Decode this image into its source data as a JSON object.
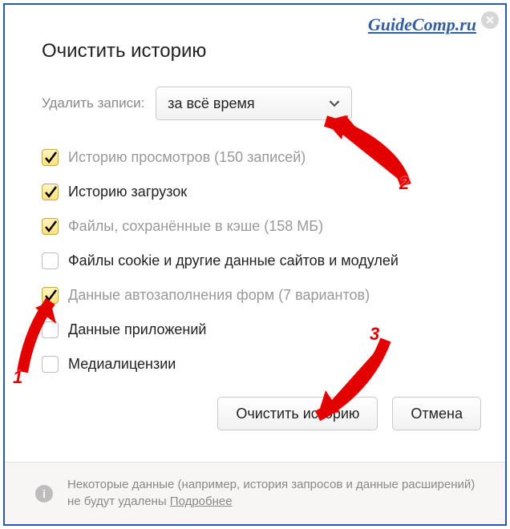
{
  "watermark": "GuideComp.ru",
  "title": "Очистить историю",
  "select": {
    "label": "Удалить записи:",
    "value": "за всё время"
  },
  "options": [
    {
      "checked": true,
      "label": "Историю просмотров",
      "suffix": " (150 записей)",
      "dim": true
    },
    {
      "checked": true,
      "label": "Историю загрузок",
      "suffix": "",
      "dim": false
    },
    {
      "checked": true,
      "label": "Файлы, сохранённые в кэше",
      "suffix": " (158 МБ)",
      "dim": true
    },
    {
      "checked": false,
      "label": "Файлы cookie и другие данные сайтов и модулей",
      "suffix": "",
      "dim": false
    },
    {
      "checked": true,
      "label": "Данные автозаполнения форм",
      "suffix": " (7 вариантов)",
      "dim": true
    },
    {
      "checked": false,
      "label": "Данные приложений",
      "suffix": "",
      "dim": false
    },
    {
      "checked": false,
      "label": "Медиалицензии",
      "suffix": "",
      "dim": false
    }
  ],
  "buttons": {
    "clear": "Очистить историю",
    "cancel": "Отмена"
  },
  "footer": {
    "text1": "Некоторые данные (например, история запросов и данные расширений) не будут удалены ",
    "more": "Подробнее"
  },
  "annotations": {
    "n1": "1",
    "n2": "2",
    "n3": "3"
  }
}
